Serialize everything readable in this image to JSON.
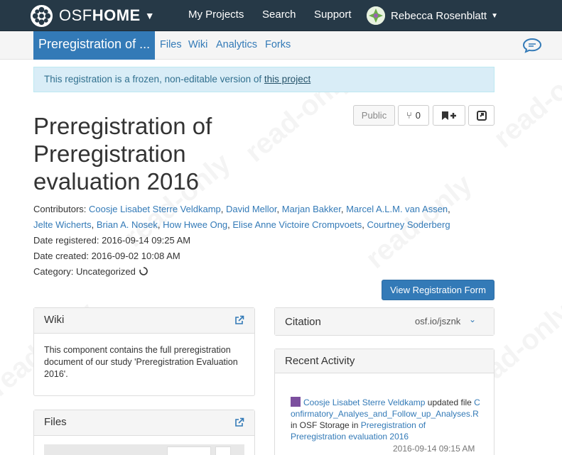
{
  "nav": {
    "brand_osf": "OSF",
    "brand_home": "HOME",
    "links": [
      "My Projects",
      "Search",
      "Support"
    ],
    "user_name": "Rebecca Rosenblatt"
  },
  "project_nav": {
    "title": "Preregistration of ...",
    "links": [
      "Files",
      "Wiki",
      "Analytics",
      "Forks"
    ]
  },
  "watermark": "read-only",
  "alert": {
    "text": "This registration is a frozen, non-editable version of ",
    "link": "this project"
  },
  "actions": {
    "public_label": "Public",
    "fork_count": "0"
  },
  "title": "Preregistration of Preregistration evaluation 2016",
  "contributors_label": "Contributors:",
  "contributors": [
    "Coosje Lisabet Sterre Veldkamp",
    "David Mellor",
    "Marjan Bakker",
    "Marcel A.L.M. van Assen",
    "Jelte Wicherts",
    "Brian A. Nosek",
    "How Hwee Ong",
    "Elise Anne Victoire Crompvoets",
    "Courtney Soderberg"
  ],
  "date_registered": "Date registered: 2016-09-14 09:25 AM",
  "date_created": "Date created: 2016-09-02 10:08 AM",
  "category": "Category: Uncategorized",
  "view_form_label": "View Registration Form",
  "wiki": {
    "title": "Wiki",
    "body": "This component contains the full preregistration document of our study 'Preregistration Evaluation 2016'."
  },
  "files": {
    "title": "Files"
  },
  "citation": {
    "title": "Citation",
    "link": "osf.io/jsznk"
  },
  "recent_activity": {
    "title": "Recent Activity",
    "user": "Coosje Lisabet Sterre Veldkamp",
    "action": " updated file ",
    "file": "Confirmatory_Analyes_and_Follow_up_Analyses.R",
    "in_text": " in OSF Storage in ",
    "project": "Preregistration of Preregistration evaluation 2016",
    "timestamp": "2016-09-14 09:15 AM"
  }
}
